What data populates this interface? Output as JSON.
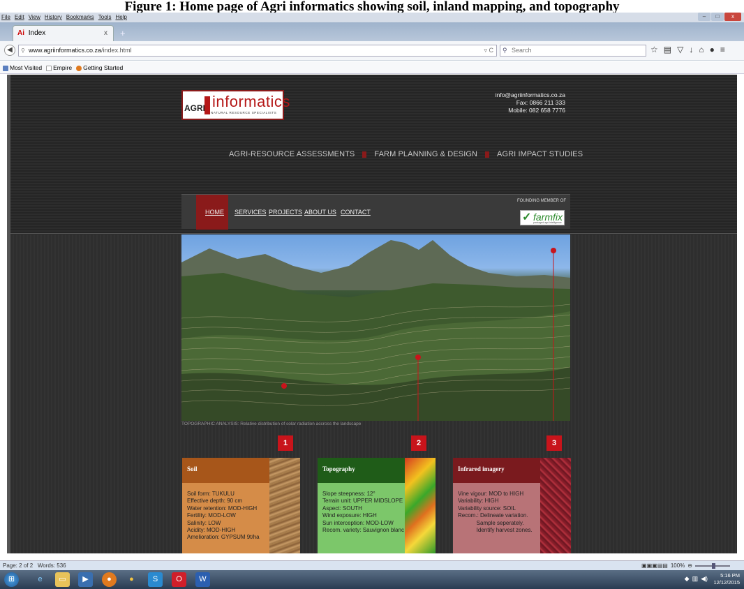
{
  "caption": "Figure 1: Home page of Agri informatics showing soil, inland mapping, and topography",
  "browser": {
    "menu": [
      "File",
      "Edit",
      "View",
      "History",
      "Bookmarks",
      "Tools",
      "Help"
    ],
    "tab": {
      "icon": "Ai",
      "title": "Index",
      "close": "x",
      "new": "+"
    },
    "url_domain": "www.agriinformatics.co.za",
    "url_path": "/index.html",
    "url_end": "▿ C",
    "search_placeholder": "Search",
    "bookmarks": [
      "Most Visited",
      "Empire",
      "Getting Started"
    ],
    "window_controls": [
      "–",
      "□",
      "x"
    ]
  },
  "site": {
    "logo": {
      "agri": "AGRI",
      "informatics": "informatics",
      "tagline": "NATURAL RESOURCE SPECIALISTS"
    },
    "contact": {
      "email": "info@agriinformatics.co.za",
      "fax": "Fax: 0866 211 333",
      "mobile": "Mobile: 082 658 7776"
    },
    "services": [
      "AGRI-RESOURCE ASSESSMENTS",
      "FARM PLANNING & DESIGN",
      "AGRI IMPACT STUDIES"
    ],
    "nav": [
      "HOME",
      "SERVICES",
      "PROJECTS",
      "ABOUT US",
      "CONTACT"
    ],
    "founding": "FOUNDING MEMBER OF",
    "farmfix": {
      "name": "farmfix",
      "sub": "packaged agri-intelligence"
    },
    "hero_caption": "TOPOGRAPHIC ANALYSIS: Relative distribution of solar radiation accross the landscape",
    "markers": [
      "1",
      "2",
      "3"
    ],
    "cards": [
      {
        "title": "Soil",
        "lines": "Soil form: TUKULU\nEffective depth: 90 cm\nWater retention: MOD-HIGH\nFertility: MOD-LOW\nSalinity: LOW\nAcidity: MOD-HIGH\nAmelioration: GYPSUM 9t/ha",
        "head_color": "#a7561a",
        "body_color": "#d58c48"
      },
      {
        "title": "Topography",
        "lines": "Slope steepness: 12°\nTerrain unit: UPPER MIDSLOPE\nAspect: SOUTH\nWind exposure: HIGH\nSun interception: MOD-LOW\nRecom. variety: Sauvignon blanc",
        "head_color": "#1f5c18",
        "body_color": "#7cc76a"
      },
      {
        "title": "Infrared imagery",
        "lines": "Vine vigour: MOD to HIGH\nVariability: HIGH\nVariability source: SOIL\nRecom.: Delineate variation.\n            Sample seperately.\n            Identify harvest zones.",
        "head_color": "#7a1a1e",
        "body_color": "#b87377"
      }
    ]
  },
  "status": {
    "page": "Page: 2 of 2",
    "words": "Words: 536",
    "zoom": "100%"
  },
  "clock": {
    "time": "5:16 PM",
    "date": "12/12/2015"
  }
}
